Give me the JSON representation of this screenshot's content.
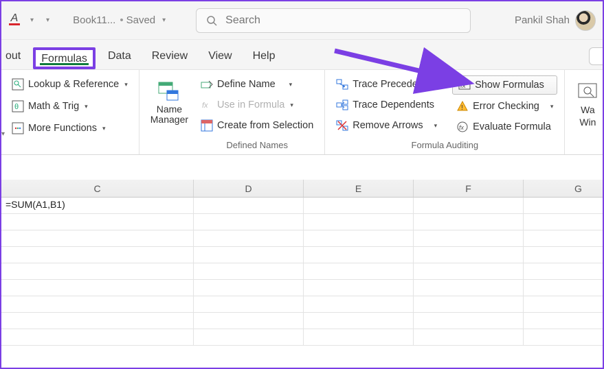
{
  "titlebar": {
    "doc_name": "Book11...",
    "save_status": "Saved",
    "search_placeholder": "Search",
    "user_name": "Pankil Shah"
  },
  "tabs": {
    "partial_left": "out",
    "items": [
      "Formulas",
      "Data",
      "Review",
      "View",
      "Help"
    ],
    "active": "Formulas"
  },
  "ribbon": {
    "function_library": {
      "lookup": "Lookup & Reference",
      "math": "Math & Trig",
      "more": "More Functions"
    },
    "name_manager": {
      "btn": "Name\nManager",
      "define": "Define Name",
      "use": "Use in Formula",
      "create": "Create from Selection",
      "group_label": "Defined Names"
    },
    "auditing": {
      "trace_prec": "Trace Precedents",
      "trace_dep": "Trace Dependents",
      "remove": "Remove Arrows",
      "show": "Show Formulas",
      "error": "Error Checking",
      "eval": "Evaluate Formula",
      "group_label": "Formula Auditing"
    },
    "watch": {
      "label": "Wa",
      "label2": "Win"
    }
  },
  "grid": {
    "columns": [
      "C",
      "D",
      "E",
      "F",
      "G"
    ],
    "rows": [
      [
        "=SUM(A1,B1)",
        "",
        "",
        "",
        ""
      ],
      [
        "",
        "",
        "",
        "",
        ""
      ],
      [
        "",
        "",
        "",
        "",
        ""
      ],
      [
        "",
        "",
        "",
        "",
        ""
      ],
      [
        "",
        "",
        "",
        "",
        ""
      ],
      [
        "",
        "",
        "",
        "",
        ""
      ],
      [
        "",
        "",
        "",
        "",
        ""
      ],
      [
        "",
        "",
        "",
        "",
        ""
      ],
      [
        "",
        "",
        "",
        "",
        ""
      ]
    ]
  }
}
